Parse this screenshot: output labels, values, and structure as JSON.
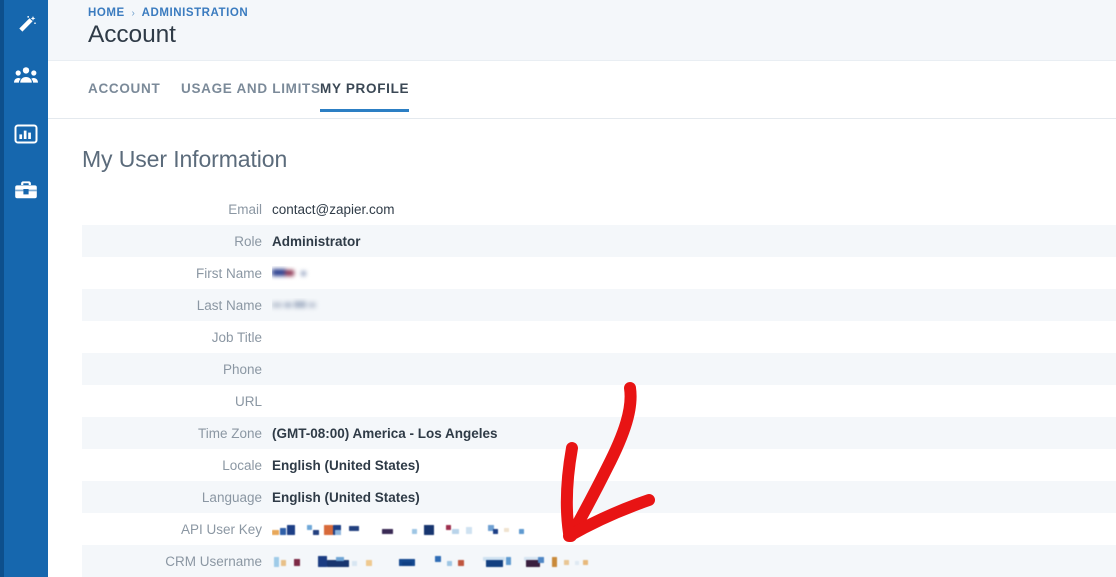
{
  "sidebar": {
    "background": "#1667ae",
    "edge_color": "#0d4f8c",
    "items": [
      {
        "icon": "magic-wand-icon",
        "label": ""
      },
      {
        "icon": "users-group-icon",
        "label": ""
      },
      {
        "icon": "bar-chart-icon",
        "label": ""
      },
      {
        "icon": "briefcase-icon",
        "label": ""
      }
    ]
  },
  "header": {
    "breadcrumb": {
      "items": [
        "HOME",
        "ADMINISTRATION"
      ],
      "separator": "›",
      "color": "#3a7bbf"
    },
    "title": "Account",
    "background": "#f4f7fa"
  },
  "tabs": {
    "active_index": 2,
    "accent_color": "#2c7fc4",
    "items": [
      {
        "label": "ACCOUNT",
        "active": false
      },
      {
        "label": "USAGE AND LIMITS",
        "active": false
      },
      {
        "label": "MY PROFILE",
        "active": true
      }
    ]
  },
  "main": {
    "section_title": "My User Information",
    "row_alt_background": "#f4f7fa",
    "rows": [
      {
        "label": "Email",
        "value": "contact@zapier.com",
        "bold": false,
        "redacted": false
      },
      {
        "label": "Role",
        "value": "Administrator",
        "bold": true,
        "redacted": false
      },
      {
        "label": "First Name",
        "value": "",
        "bold": true,
        "redacted": "blur-name-short"
      },
      {
        "label": "Last Name",
        "value": "",
        "bold": true,
        "redacted": "blur-name-long"
      },
      {
        "label": "Job Title",
        "value": "",
        "bold": true,
        "redacted": false
      },
      {
        "label": "Phone",
        "value": "",
        "bold": true,
        "redacted": false
      },
      {
        "label": "URL",
        "value": "",
        "bold": true,
        "redacted": false
      },
      {
        "label": "Time Zone",
        "value": "(GMT-08:00) America - Los Angeles",
        "bold": true,
        "redacted": false
      },
      {
        "label": "Locale",
        "value": "English (United States)",
        "bold": true,
        "redacted": false
      },
      {
        "label": "Language",
        "value": "English (United States)",
        "bold": true,
        "redacted": false
      },
      {
        "label": "API User Key",
        "value": "",
        "bold": true,
        "redacted": "pixel-key"
      },
      {
        "label": "CRM Username",
        "value": "",
        "bold": true,
        "redacted": "pixel-username"
      }
    ]
  },
  "annotation": {
    "type": "hand-drawn-arrow",
    "color": "#e81414",
    "direction": "down-left",
    "points_at": "API User Key"
  }
}
